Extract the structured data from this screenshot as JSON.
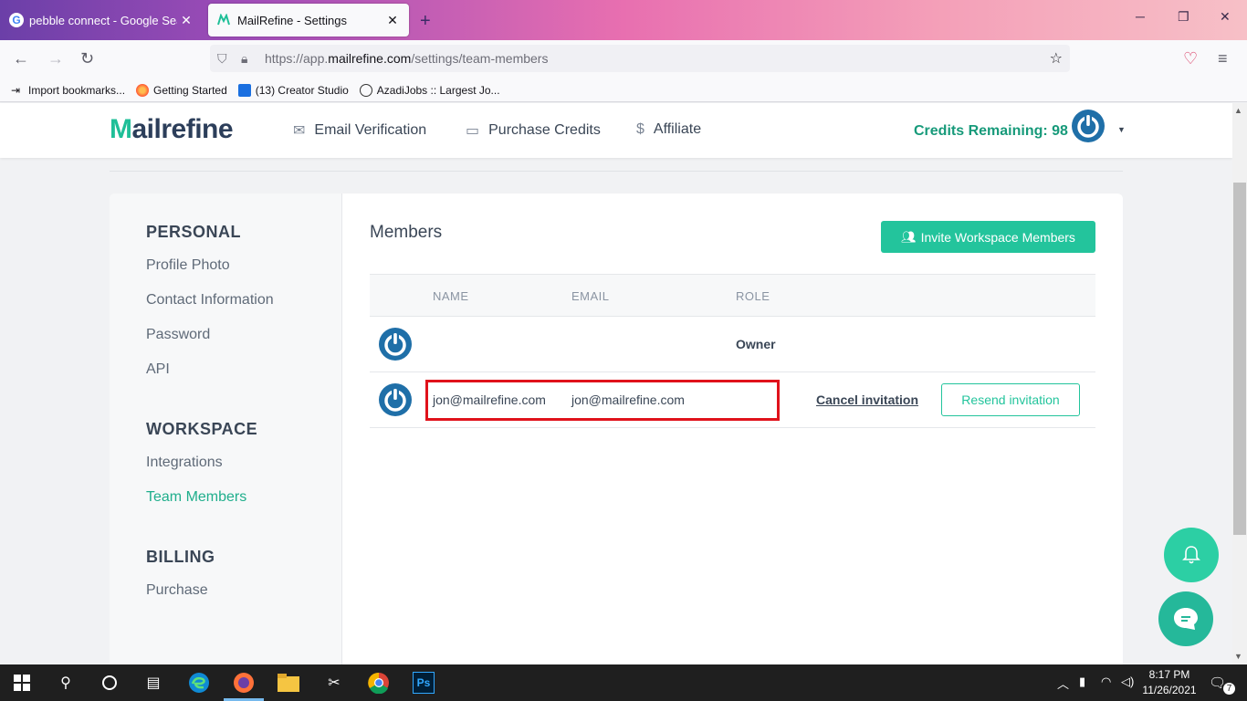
{
  "browser": {
    "tabs": [
      {
        "title": "pebble connect - Google Search",
        "favicon": "google-icon",
        "active": false
      },
      {
        "title": "MailRefine - Settings",
        "favicon": "mailrefine-icon",
        "active": true
      }
    ],
    "url_prefix": "https://app.",
    "url_host": "mailrefine.com",
    "url_path": "/settings/team-members",
    "bookmarks": [
      {
        "label": "Import bookmarks...",
        "icon": "import-icon"
      },
      {
        "label": "Getting Started",
        "icon": "firefox-icon"
      },
      {
        "label": "(13) Creator Studio",
        "icon": "creator-studio-icon"
      },
      {
        "label": "AzadiJobs :: Largest Jo...",
        "icon": "globe-icon"
      }
    ]
  },
  "header": {
    "logo_prefix": "M",
    "logo_rest": "ailrefine",
    "nav": [
      {
        "label": "Email Verification",
        "icon": "envelope-open-icon"
      },
      {
        "label": "Purchase Credits",
        "icon": "credit-card-icon"
      },
      {
        "label": "Affiliate",
        "icon": "dollar-icon"
      }
    ],
    "credits": "Credits Remaining: 98"
  },
  "sidebar": {
    "sections": [
      {
        "title": "PERSONAL",
        "items": [
          "Profile Photo",
          "Contact Information",
          "Password",
          "API"
        ]
      },
      {
        "title": "WORKSPACE",
        "items": [
          "Integrations",
          "Team Members"
        ]
      },
      {
        "title": "BILLING",
        "items": [
          "Purchase"
        ]
      }
    ],
    "active_item": "Team Members"
  },
  "members": {
    "title": "Members",
    "invite_button": "Invite Workspace Members",
    "columns": [
      "NAME",
      "EMAIL",
      "ROLE"
    ],
    "rows": [
      {
        "name": "",
        "email": "",
        "role": "Owner"
      },
      {
        "name": "jon@mailrefine.com",
        "email": "jon@mailrefine.com",
        "role": "",
        "cancel_label": "Cancel invitation",
        "resend_label": "Resend invitation"
      }
    ]
  },
  "taskbar": {
    "time": "8:17 PM",
    "date": "11/26/2021",
    "notification_count": "7"
  },
  "colors": {
    "accent": "#23c49c",
    "highlight_box": "#e0121b",
    "text_dark": "#3a4656"
  }
}
